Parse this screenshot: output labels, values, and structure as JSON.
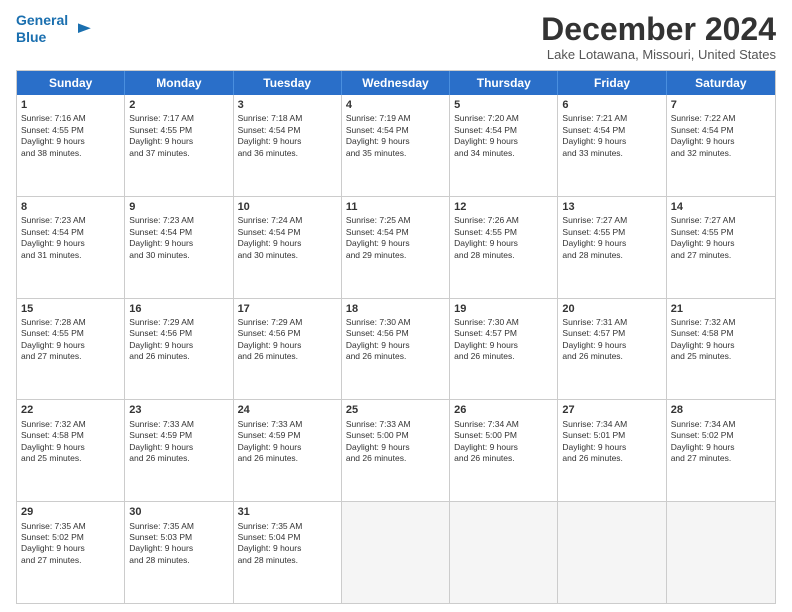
{
  "header": {
    "logo_line1": "General",
    "logo_line2": "Blue",
    "month": "December 2024",
    "location": "Lake Lotawana, Missouri, United States"
  },
  "weekdays": [
    "Sunday",
    "Monday",
    "Tuesday",
    "Wednesday",
    "Thursday",
    "Friday",
    "Saturday"
  ],
  "rows": [
    [
      {
        "num": "1",
        "lines": [
          "Sunrise: 7:16 AM",
          "Sunset: 4:55 PM",
          "Daylight: 9 hours",
          "and 38 minutes."
        ]
      },
      {
        "num": "2",
        "lines": [
          "Sunrise: 7:17 AM",
          "Sunset: 4:55 PM",
          "Daylight: 9 hours",
          "and 37 minutes."
        ]
      },
      {
        "num": "3",
        "lines": [
          "Sunrise: 7:18 AM",
          "Sunset: 4:54 PM",
          "Daylight: 9 hours",
          "and 36 minutes."
        ]
      },
      {
        "num": "4",
        "lines": [
          "Sunrise: 7:19 AM",
          "Sunset: 4:54 PM",
          "Daylight: 9 hours",
          "and 35 minutes."
        ]
      },
      {
        "num": "5",
        "lines": [
          "Sunrise: 7:20 AM",
          "Sunset: 4:54 PM",
          "Daylight: 9 hours",
          "and 34 minutes."
        ]
      },
      {
        "num": "6",
        "lines": [
          "Sunrise: 7:21 AM",
          "Sunset: 4:54 PM",
          "Daylight: 9 hours",
          "and 33 minutes."
        ]
      },
      {
        "num": "7",
        "lines": [
          "Sunrise: 7:22 AM",
          "Sunset: 4:54 PM",
          "Daylight: 9 hours",
          "and 32 minutes."
        ]
      }
    ],
    [
      {
        "num": "8",
        "lines": [
          "Sunrise: 7:23 AM",
          "Sunset: 4:54 PM",
          "Daylight: 9 hours",
          "and 31 minutes."
        ]
      },
      {
        "num": "9",
        "lines": [
          "Sunrise: 7:23 AM",
          "Sunset: 4:54 PM",
          "Daylight: 9 hours",
          "and 30 minutes."
        ]
      },
      {
        "num": "10",
        "lines": [
          "Sunrise: 7:24 AM",
          "Sunset: 4:54 PM",
          "Daylight: 9 hours",
          "and 30 minutes."
        ]
      },
      {
        "num": "11",
        "lines": [
          "Sunrise: 7:25 AM",
          "Sunset: 4:54 PM",
          "Daylight: 9 hours",
          "and 29 minutes."
        ]
      },
      {
        "num": "12",
        "lines": [
          "Sunrise: 7:26 AM",
          "Sunset: 4:55 PM",
          "Daylight: 9 hours",
          "and 28 minutes."
        ]
      },
      {
        "num": "13",
        "lines": [
          "Sunrise: 7:27 AM",
          "Sunset: 4:55 PM",
          "Daylight: 9 hours",
          "and 28 minutes."
        ]
      },
      {
        "num": "14",
        "lines": [
          "Sunrise: 7:27 AM",
          "Sunset: 4:55 PM",
          "Daylight: 9 hours",
          "and 27 minutes."
        ]
      }
    ],
    [
      {
        "num": "15",
        "lines": [
          "Sunrise: 7:28 AM",
          "Sunset: 4:55 PM",
          "Daylight: 9 hours",
          "and 27 minutes."
        ]
      },
      {
        "num": "16",
        "lines": [
          "Sunrise: 7:29 AM",
          "Sunset: 4:56 PM",
          "Daylight: 9 hours",
          "and 26 minutes."
        ]
      },
      {
        "num": "17",
        "lines": [
          "Sunrise: 7:29 AM",
          "Sunset: 4:56 PM",
          "Daylight: 9 hours",
          "and 26 minutes."
        ]
      },
      {
        "num": "18",
        "lines": [
          "Sunrise: 7:30 AM",
          "Sunset: 4:56 PM",
          "Daylight: 9 hours",
          "and 26 minutes."
        ]
      },
      {
        "num": "19",
        "lines": [
          "Sunrise: 7:30 AM",
          "Sunset: 4:57 PM",
          "Daylight: 9 hours",
          "and 26 minutes."
        ]
      },
      {
        "num": "20",
        "lines": [
          "Sunrise: 7:31 AM",
          "Sunset: 4:57 PM",
          "Daylight: 9 hours",
          "and 26 minutes."
        ]
      },
      {
        "num": "21",
        "lines": [
          "Sunrise: 7:32 AM",
          "Sunset: 4:58 PM",
          "Daylight: 9 hours",
          "and 25 minutes."
        ]
      }
    ],
    [
      {
        "num": "22",
        "lines": [
          "Sunrise: 7:32 AM",
          "Sunset: 4:58 PM",
          "Daylight: 9 hours",
          "and 25 minutes."
        ]
      },
      {
        "num": "23",
        "lines": [
          "Sunrise: 7:33 AM",
          "Sunset: 4:59 PM",
          "Daylight: 9 hours",
          "and 26 minutes."
        ]
      },
      {
        "num": "24",
        "lines": [
          "Sunrise: 7:33 AM",
          "Sunset: 4:59 PM",
          "Daylight: 9 hours",
          "and 26 minutes."
        ]
      },
      {
        "num": "25",
        "lines": [
          "Sunrise: 7:33 AM",
          "Sunset: 5:00 PM",
          "Daylight: 9 hours",
          "and 26 minutes."
        ]
      },
      {
        "num": "26",
        "lines": [
          "Sunrise: 7:34 AM",
          "Sunset: 5:00 PM",
          "Daylight: 9 hours",
          "and 26 minutes."
        ]
      },
      {
        "num": "27",
        "lines": [
          "Sunrise: 7:34 AM",
          "Sunset: 5:01 PM",
          "Daylight: 9 hours",
          "and 26 minutes."
        ]
      },
      {
        "num": "28",
        "lines": [
          "Sunrise: 7:34 AM",
          "Sunset: 5:02 PM",
          "Daylight: 9 hours",
          "and 27 minutes."
        ]
      }
    ],
    [
      {
        "num": "29",
        "lines": [
          "Sunrise: 7:35 AM",
          "Sunset: 5:02 PM",
          "Daylight: 9 hours",
          "and 27 minutes."
        ]
      },
      {
        "num": "30",
        "lines": [
          "Sunrise: 7:35 AM",
          "Sunset: 5:03 PM",
          "Daylight: 9 hours",
          "and 28 minutes."
        ]
      },
      {
        "num": "31",
        "lines": [
          "Sunrise: 7:35 AM",
          "Sunset: 5:04 PM",
          "Daylight: 9 hours",
          "and 28 minutes."
        ]
      },
      {
        "num": "",
        "lines": []
      },
      {
        "num": "",
        "lines": []
      },
      {
        "num": "",
        "lines": []
      },
      {
        "num": "",
        "lines": []
      }
    ]
  ]
}
